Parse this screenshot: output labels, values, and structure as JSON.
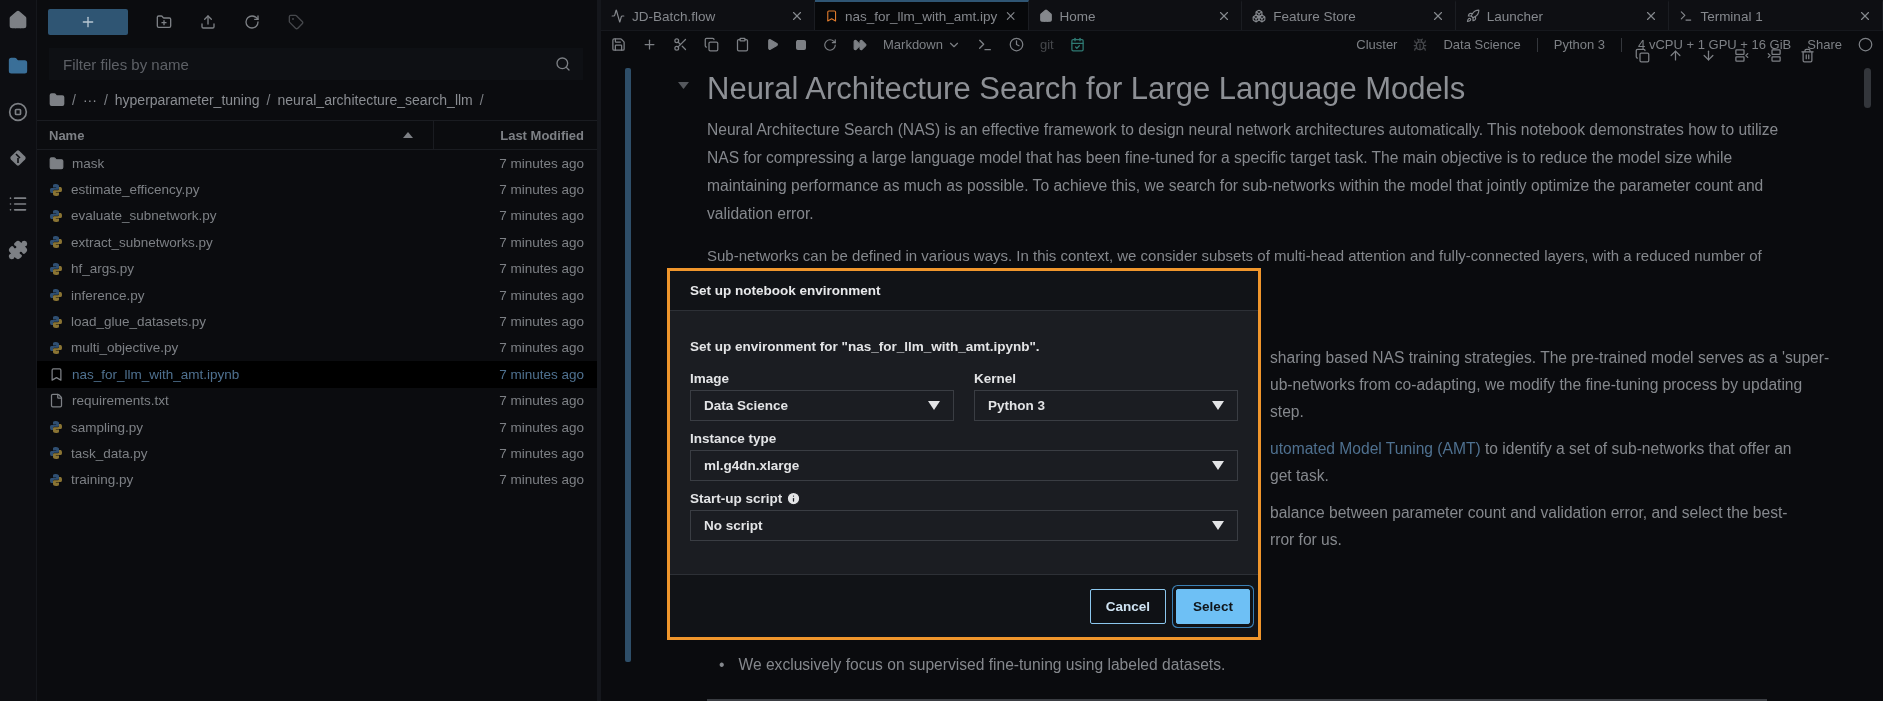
{
  "activity_bar": {
    "items": [
      {
        "kind": "home",
        "selected": false
      },
      {
        "kind": "files",
        "selected": true
      },
      {
        "kind": "running",
        "selected": false
      },
      {
        "kind": "git",
        "selected": false
      },
      {
        "kind": "toc",
        "selected": false
      },
      {
        "kind": "extensions",
        "selected": false
      }
    ]
  },
  "file_browser": {
    "filter": {
      "placeholder": "Filter files by name"
    },
    "breadcrumb": {
      "separator": "/",
      "items": [
        "···",
        "hyperparameter_tuning",
        "neural_architecture_search_llm"
      ]
    },
    "columns": [
      "Name",
      "Last Modified"
    ],
    "files": [
      {
        "name": "mask",
        "kind": "folder",
        "modified": "7 minutes ago",
        "selected": false
      },
      {
        "name": "estimate_efficency.py",
        "kind": "python",
        "modified": "7 minutes ago",
        "selected": false
      },
      {
        "name": "evaluate_subnetwork.py",
        "kind": "python",
        "modified": "7 minutes ago",
        "selected": false
      },
      {
        "name": "extract_subnetworks.py",
        "kind": "python",
        "modified": "7 minutes ago",
        "selected": false
      },
      {
        "name": "hf_args.py",
        "kind": "python",
        "modified": "7 minutes ago",
        "selected": false
      },
      {
        "name": "inference.py",
        "kind": "python",
        "modified": "7 minutes ago",
        "selected": false
      },
      {
        "name": "load_glue_datasets.py",
        "kind": "python",
        "modified": "7 minutes ago",
        "selected": false
      },
      {
        "name": "multi_objective.py",
        "kind": "python",
        "modified": "7 minutes ago",
        "selected": false
      },
      {
        "name": "nas_for_llm_with_amt.ipynb",
        "kind": "notebook",
        "modified": "7 minutes ago",
        "selected": true
      },
      {
        "name": "requirements.txt",
        "kind": "text",
        "modified": "7 minutes ago",
        "selected": false
      },
      {
        "name": "sampling.py",
        "kind": "python",
        "modified": "7 minutes ago",
        "selected": false
      },
      {
        "name": "task_data.py",
        "kind": "python",
        "modified": "7 minutes ago",
        "selected": false
      },
      {
        "name": "training.py",
        "kind": "python",
        "modified": "7 minutes ago",
        "selected": false
      }
    ]
  },
  "tabs": [
    {
      "label": "JD-Batch.flow",
      "kind": "flow",
      "selected": false
    },
    {
      "label": "nas_for_llm_with_amt.ipy",
      "kind": "notebook",
      "selected": true
    },
    {
      "label": "Home",
      "kind": "home",
      "selected": false
    },
    {
      "label": "Feature Store",
      "kind": "store",
      "selected": false
    },
    {
      "label": "Launcher",
      "kind": "launcher",
      "selected": false
    },
    {
      "label": "Terminal 1",
      "kind": "terminal",
      "selected": false
    }
  ],
  "toolbar": {
    "cell_type": "Markdown",
    "git": "git",
    "cluster": "Cluster",
    "image": "Data Science",
    "kernel": "Python 3",
    "instance": "4 vCPU + 1 GPU + 16 GiB",
    "share": "Share"
  },
  "notebook": {
    "heading": "Neural Architecture Search for Large Language Models",
    "paragraph_1": "Neural Architecture Search (NAS) is an effective framework to design neural network architectures automatically. This notebook demonstrates how to utilize NAS for compressing a large language model that has been fine-tuned for a specific target task. The main objective is to reduce the model size while maintaining performance as much as possible. To achieve this, we search for sub-networks within the model that jointly optimize the parameter count and validation error.",
    "paragraph_2": "Sub-networks can be defined in various ways. In this context, we consider subsets of multi-head attention and fully-connected layers, with a reduced number of",
    "fragments": [
      {
        "lines": [
          {
            "text": "sharing based NAS training strategies. The pre-trained model serves as a 'super-"
          },
          {
            "text": "ub-networks from co-adapting, we modify the fine-tuning process by updating"
          },
          {
            "text": "step."
          }
        ]
      },
      {
        "lines": [
          {
            "link": "utomated Model Tuning (AMT)",
            "text": " to identify a set of sub-networks that offer an"
          },
          {
            "text": "get task."
          }
        ]
      },
      {
        "lines": [
          {
            "text": "balance between parameter count and validation error, and select the best-"
          },
          {
            "text": "rror for us."
          }
        ]
      }
    ],
    "bullet_marker": "•",
    "bullet": "We exclusively focus on supervised fine-tuning using labeled datasets."
  },
  "dialog": {
    "title": "Set up notebook environment",
    "intro": "Set up environment for \"nas_for_llm_with_amt.ipynb\".",
    "fields": [
      {
        "label": "Image",
        "value": "Data Science",
        "info": false
      },
      {
        "label": "Kernel",
        "value": "Python 3",
        "info": false
      },
      {
        "label": "Instance type",
        "value": "ml.g4dn.xlarge",
        "info": false
      },
      {
        "label": "Start-up script",
        "value": "No script",
        "info": true
      }
    ],
    "buttons": [
      {
        "label": "Cancel",
        "kind": "secondary"
      },
      {
        "label": "Select",
        "kind": "primary"
      }
    ]
  }
}
